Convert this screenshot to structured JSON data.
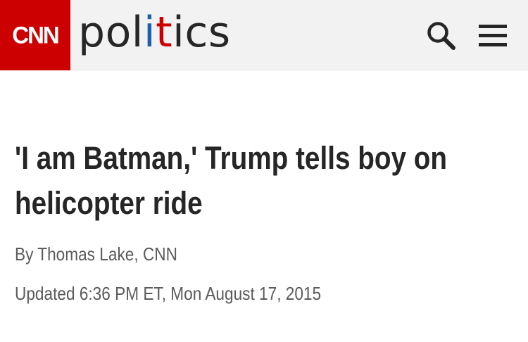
{
  "header": {
    "logo_text": "CNN",
    "section_title_parts": [
      "pol",
      "i",
      "t",
      "i",
      "cs"
    ],
    "icons": {
      "search": "search-icon",
      "menu": "hamburger-menu-icon"
    },
    "colors": {
      "logo_bg": "#cc0000",
      "bar_bg": "#f2f2f2",
      "accent_blue": "#1f5fb0",
      "accent_red": "#cc0000"
    }
  },
  "article": {
    "headline": "'I am Batman,' Trump tells boy on helicopter ride",
    "byline_prefix": "By ",
    "author": "Thomas Lake, CNN",
    "updated": "Updated 6:36 PM ET, Mon August 17, 2015"
  }
}
